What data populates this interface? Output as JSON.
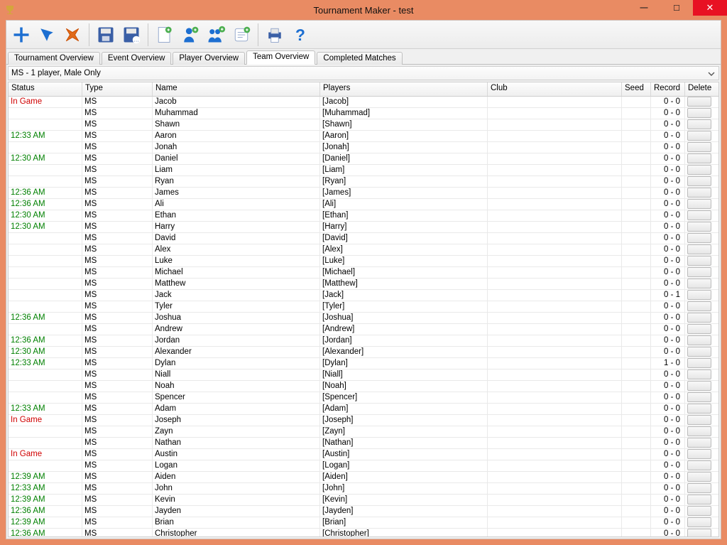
{
  "window": {
    "title": "Tournament Maker - test"
  },
  "tabs": [
    {
      "label": "Tournament Overview"
    },
    {
      "label": "Event Overview"
    },
    {
      "label": "Player Overview"
    },
    {
      "label": "Team Overview",
      "active": true
    },
    {
      "label": "Completed Matches"
    }
  ],
  "dropdown": {
    "selected": "MS - 1 player, Male Only"
  },
  "columns": {
    "status": "Status",
    "type": "Type",
    "name": "Name",
    "players": "Players",
    "club": "Club",
    "seed": "Seed",
    "record": "Record",
    "delete": "Delete"
  },
  "toolbarIcons": {
    "add": "add-icon",
    "edit": "edit-icon",
    "delete": "delete-icon",
    "save": "save-icon",
    "saveAs": "save-as-icon",
    "newDoc": "new-document-icon",
    "addPlayer": "add-player-icon",
    "addTeam": "add-team-icon",
    "registration": "new-registration-icon",
    "print": "print-icon",
    "help": "help-icon"
  },
  "rows": [
    {
      "status": "In Game",
      "statusKind": "ingame",
      "type": "MS",
      "name": "Jacob",
      "players": "[Jacob]",
      "club": "",
      "seed": "",
      "record": "0 - 0"
    },
    {
      "status": "",
      "type": "MS",
      "name": "Muhammad",
      "players": "[Muhammad]",
      "club": "",
      "seed": "",
      "record": "0 - 0"
    },
    {
      "status": "",
      "type": "MS",
      "name": "Shawn",
      "players": "[Shawn]",
      "club": "",
      "seed": "",
      "record": "0 - 0"
    },
    {
      "status": "12:33 AM",
      "statusKind": "time",
      "type": "MS",
      "name": "Aaron",
      "players": "[Aaron]",
      "club": "",
      "seed": "",
      "record": "0 - 0"
    },
    {
      "status": "",
      "type": "MS",
      "name": "Jonah",
      "players": "[Jonah]",
      "club": "",
      "seed": "",
      "record": "0 - 0"
    },
    {
      "status": "12:30 AM",
      "statusKind": "time",
      "type": "MS",
      "name": "Daniel",
      "players": "[Daniel]",
      "club": "",
      "seed": "",
      "record": "0 - 0"
    },
    {
      "status": "",
      "type": "MS",
      "name": "Liam",
      "players": "[Liam]",
      "club": "",
      "seed": "",
      "record": "0 - 0"
    },
    {
      "status": "",
      "type": "MS",
      "name": "Ryan",
      "players": "[Ryan]",
      "club": "",
      "seed": "",
      "record": "0 - 0"
    },
    {
      "status": "12:36 AM",
      "statusKind": "time",
      "type": "MS",
      "name": "James",
      "players": "[James]",
      "club": "",
      "seed": "",
      "record": "0 - 0"
    },
    {
      "status": "12:36 AM",
      "statusKind": "time",
      "type": "MS",
      "name": "Ali",
      "players": "[Ali]",
      "club": "",
      "seed": "",
      "record": "0 - 0"
    },
    {
      "status": "12:30 AM",
      "statusKind": "time",
      "type": "MS",
      "name": "Ethan",
      "players": "[Ethan]",
      "club": "",
      "seed": "",
      "record": "0 - 0"
    },
    {
      "status": "12:30 AM",
      "statusKind": "time",
      "type": "MS",
      "name": "Harry",
      "players": "[Harry]",
      "club": "",
      "seed": "",
      "record": "0 - 0"
    },
    {
      "status": "",
      "type": "MS",
      "name": "David",
      "players": "[David]",
      "club": "",
      "seed": "",
      "record": "0 - 0"
    },
    {
      "status": "",
      "type": "MS",
      "name": "Alex",
      "players": "[Alex]",
      "club": "",
      "seed": "",
      "record": "0 - 0"
    },
    {
      "status": "",
      "type": "MS",
      "name": "Luke",
      "players": "[Luke]",
      "club": "",
      "seed": "",
      "record": "0 - 0"
    },
    {
      "status": "",
      "type": "MS",
      "name": "Michael",
      "players": "[Michael]",
      "club": "",
      "seed": "",
      "record": "0 - 0"
    },
    {
      "status": "",
      "type": "MS",
      "name": "Matthew",
      "players": "[Matthew]",
      "club": "",
      "seed": "",
      "record": "0 - 0"
    },
    {
      "status": "",
      "type": "MS",
      "name": "Jack",
      "players": "[Jack]",
      "club": "",
      "seed": "",
      "record": "0 - 1"
    },
    {
      "status": "",
      "type": "MS",
      "name": "Tyler",
      "players": "[Tyler]",
      "club": "",
      "seed": "",
      "record": "0 - 0"
    },
    {
      "status": "12:36 AM",
      "statusKind": "time",
      "type": "MS",
      "name": "Joshua",
      "players": "[Joshua]",
      "club": "",
      "seed": "",
      "record": "0 - 0"
    },
    {
      "status": "",
      "type": "MS",
      "name": "Andrew",
      "players": "[Andrew]",
      "club": "",
      "seed": "",
      "record": "0 - 0"
    },
    {
      "status": "12:36 AM",
      "statusKind": "time",
      "type": "MS",
      "name": "Jordan",
      "players": "[Jordan]",
      "club": "",
      "seed": "",
      "record": "0 - 0"
    },
    {
      "status": "12:30 AM",
      "statusKind": "time",
      "type": "MS",
      "name": "Alexander",
      "players": "[Alexander]",
      "club": "",
      "seed": "",
      "record": "0 - 0"
    },
    {
      "status": "12:33 AM",
      "statusKind": "time",
      "type": "MS",
      "name": "Dylan",
      "players": "[Dylan]",
      "club": "",
      "seed": "",
      "record": "1 - 0"
    },
    {
      "status": "",
      "type": "MS",
      "name": "Niall",
      "players": "[Niall]",
      "club": "",
      "seed": "",
      "record": "0 - 0"
    },
    {
      "status": "",
      "type": "MS",
      "name": "Noah",
      "players": "[Noah]",
      "club": "",
      "seed": "",
      "record": "0 - 0"
    },
    {
      "status": "",
      "type": "MS",
      "name": "Spencer",
      "players": "[Spencer]",
      "club": "",
      "seed": "",
      "record": "0 - 0"
    },
    {
      "status": "12:33 AM",
      "statusKind": "time",
      "type": "MS",
      "name": "Adam",
      "players": "[Adam]",
      "club": "",
      "seed": "",
      "record": "0 - 0"
    },
    {
      "status": "In Game",
      "statusKind": "ingame",
      "type": "MS",
      "name": "Joseph",
      "players": "[Joseph]",
      "club": "",
      "seed": "",
      "record": "0 - 0"
    },
    {
      "status": "",
      "type": "MS",
      "name": "Zayn",
      "players": "[Zayn]",
      "club": "",
      "seed": "",
      "record": "0 - 0"
    },
    {
      "status": "",
      "type": "MS",
      "name": "Nathan",
      "players": "[Nathan]",
      "club": "",
      "seed": "",
      "record": "0 - 0"
    },
    {
      "status": "In Game",
      "statusKind": "ingame",
      "type": "MS",
      "name": "Austin",
      "players": "[Austin]",
      "club": "",
      "seed": "",
      "record": "0 - 0"
    },
    {
      "status": "",
      "type": "MS",
      "name": "Logan",
      "players": "[Logan]",
      "club": "",
      "seed": "",
      "record": "0 - 0"
    },
    {
      "status": "12:39 AM",
      "statusKind": "time",
      "type": "MS",
      "name": "Aiden",
      "players": "[Aiden]",
      "club": "",
      "seed": "",
      "record": "0 - 0"
    },
    {
      "status": "12:33 AM",
      "statusKind": "time",
      "type": "MS",
      "name": "John",
      "players": "[John]",
      "club": "",
      "seed": "",
      "record": "0 - 0"
    },
    {
      "status": "12:39 AM",
      "statusKind": "time",
      "type": "MS",
      "name": "Kevin",
      "players": "[Kevin]",
      "club": "",
      "seed": "",
      "record": "0 - 0"
    },
    {
      "status": "12:36 AM",
      "statusKind": "time",
      "type": "MS",
      "name": "Jayden",
      "players": "[Jayden]",
      "club": "",
      "seed": "",
      "record": "0 - 0"
    },
    {
      "status": "12:39 AM",
      "statusKind": "time",
      "type": "MS",
      "name": "Brian",
      "players": "[Brian]",
      "club": "",
      "seed": "",
      "record": "0 - 0"
    },
    {
      "status": "12:36 AM",
      "statusKind": "time",
      "type": "MS",
      "name": "Christopher",
      "players": "[Christopher]",
      "club": "",
      "seed": "",
      "record": "0 - 0"
    }
  ]
}
